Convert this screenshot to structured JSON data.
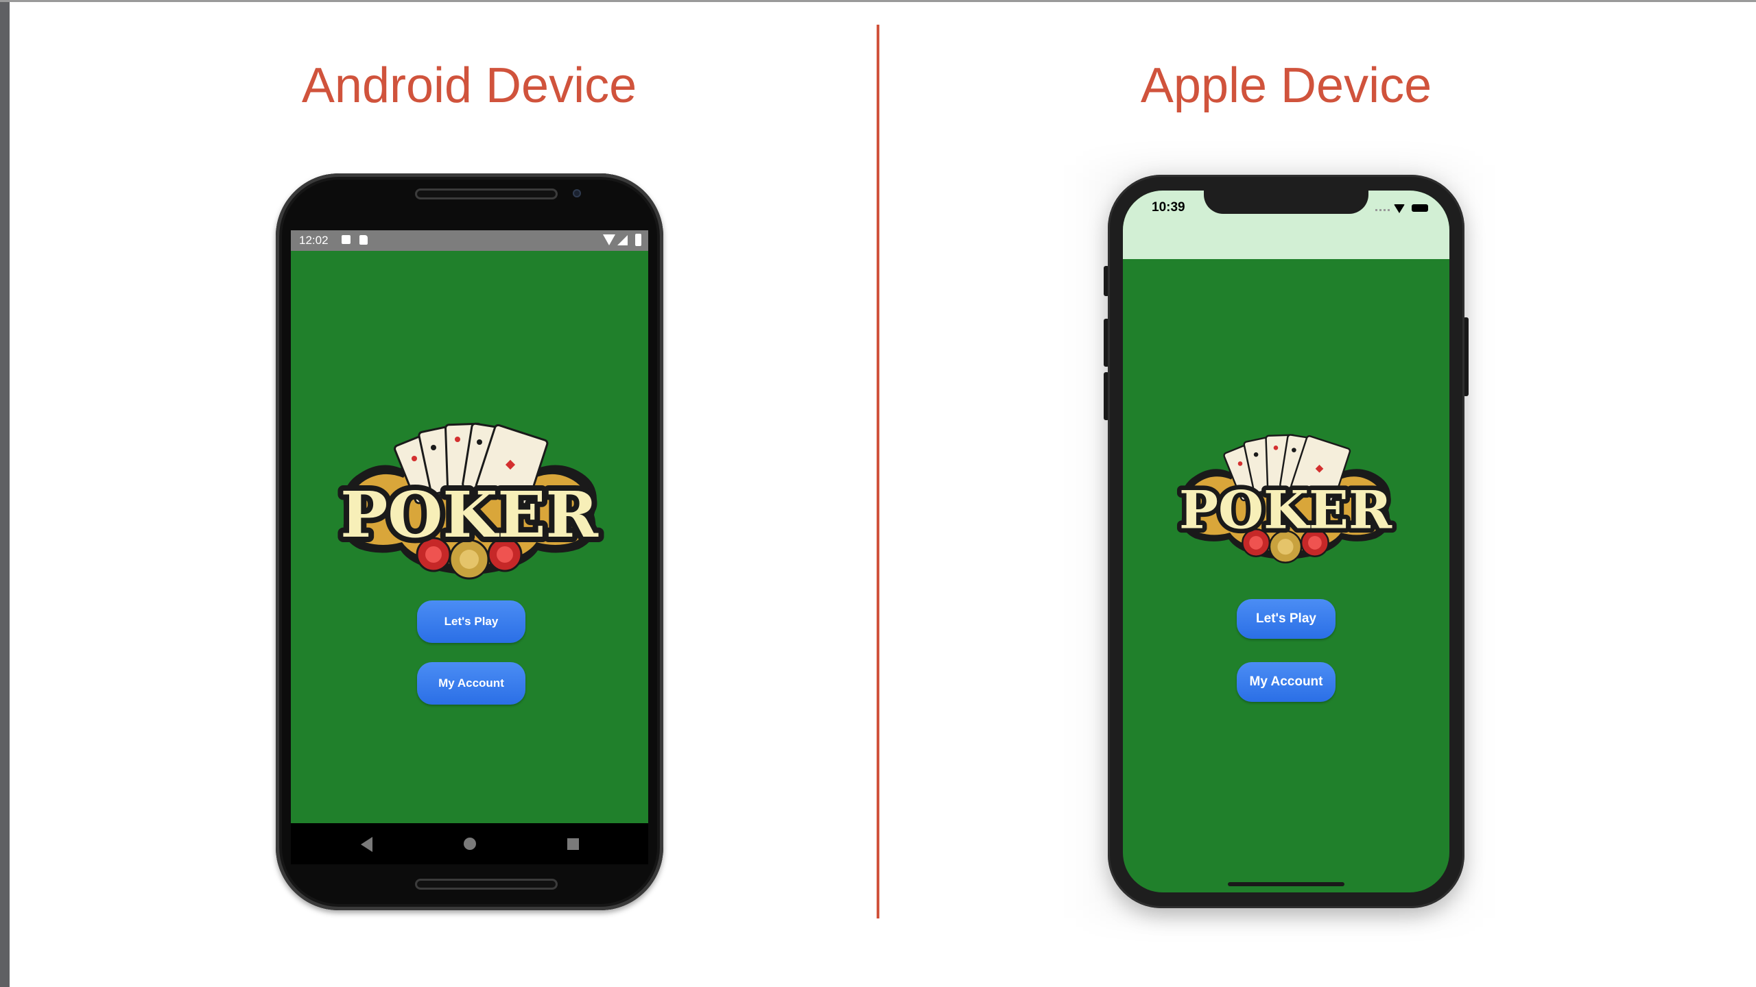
{
  "headings": {
    "android": "Android Device",
    "apple": "Apple Device"
  },
  "android": {
    "status_time": "12:02",
    "logo_text": "POKER",
    "buttons": {
      "play": "Let's Play",
      "account": "My Account"
    }
  },
  "apple": {
    "status_time": "10:39",
    "logo_text": "POKER",
    "buttons": {
      "play": "Let's Play",
      "account": "My Account"
    }
  },
  "colors": {
    "heading": "#d0533c",
    "felt": "#20802b",
    "button": "#3b7ff0",
    "ios_status_bg": "#d2efd4"
  }
}
